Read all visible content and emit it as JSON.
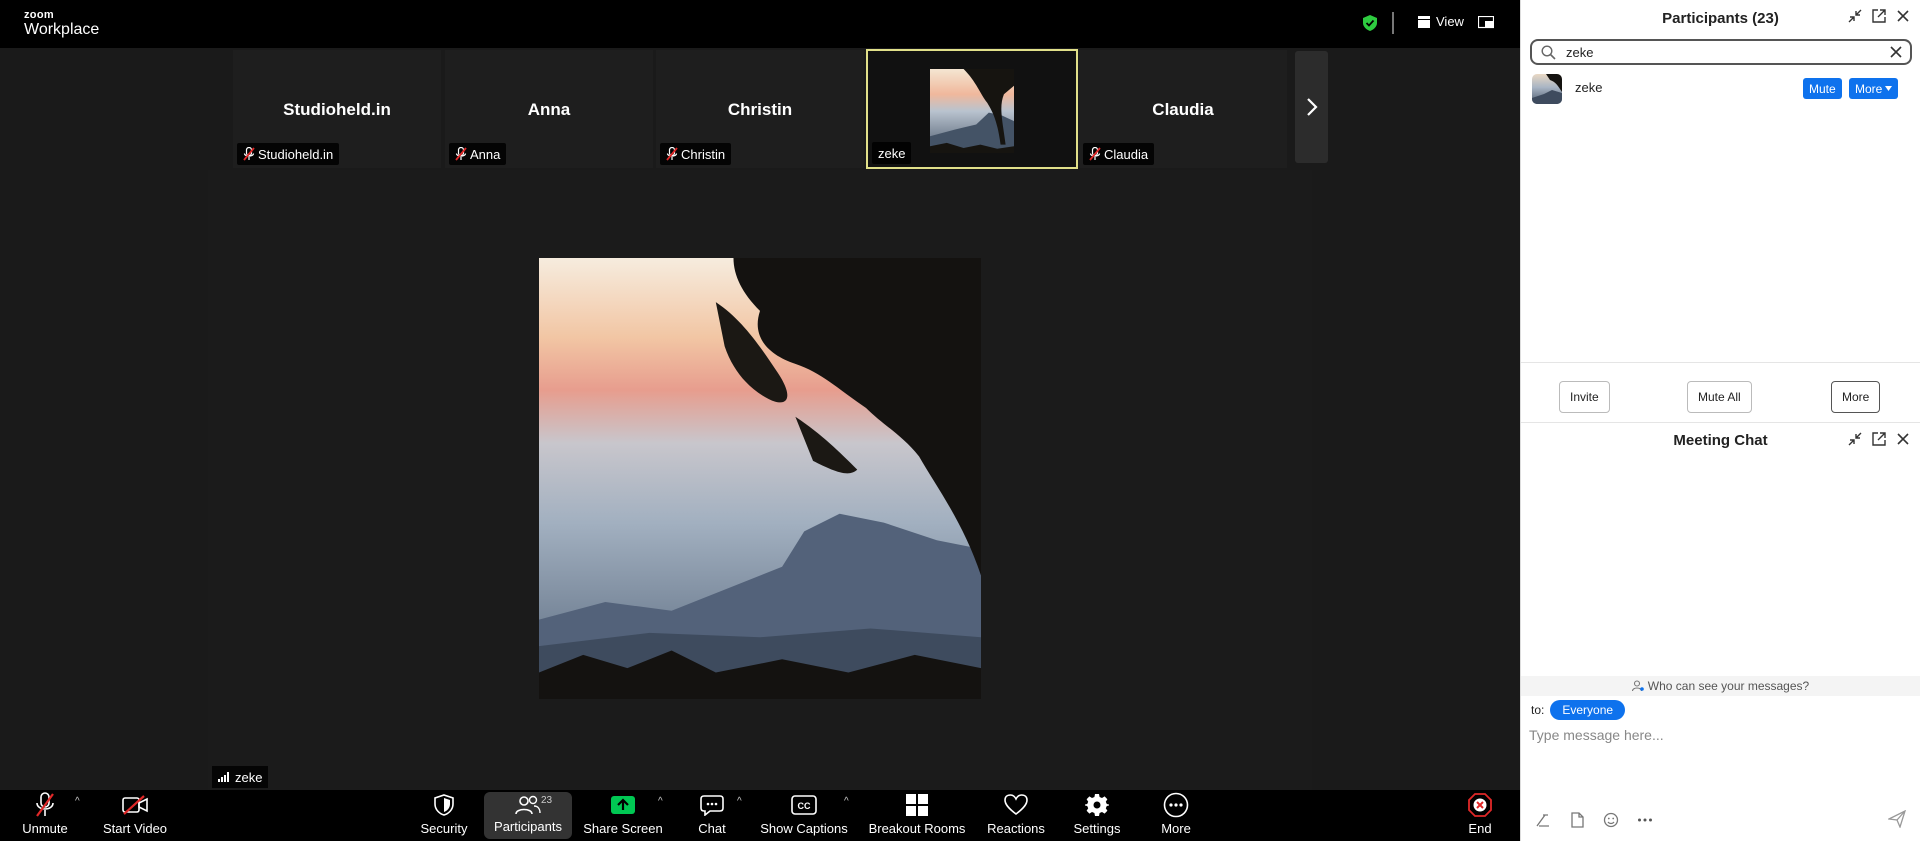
{
  "app": {
    "logo_top": "zoom",
    "logo_bottom": "Workplace",
    "view_label": "View"
  },
  "thumbnails": [
    {
      "name": "Studioheld.in",
      "tag": "Studioheld.in",
      "muted": true
    },
    {
      "name": "Anna",
      "tag": "Anna",
      "muted": true
    },
    {
      "name": "Christin",
      "tag": "Christin",
      "muted": true
    },
    {
      "name": "",
      "tag": "zeke",
      "muted": false,
      "active": true
    },
    {
      "name": "Claudia",
      "tag": "Claudia",
      "muted": true
    }
  ],
  "stage": {
    "speaker_tag": "zeke"
  },
  "toolbar": {
    "unmute": "Unmute",
    "start_video": "Start Video",
    "security": "Security",
    "participants": "Participants",
    "participants_count": "23",
    "share_screen": "Share Screen",
    "chat": "Chat",
    "show_captions": "Show Captions",
    "breakout_rooms": "Breakout Rooms",
    "reactions": "Reactions",
    "settings": "Settings",
    "more": "More",
    "end": "End"
  },
  "participants_panel": {
    "title": "Participants (23)",
    "search_value": "zeke",
    "results": [
      {
        "name": "zeke",
        "mute_label": "Mute",
        "more_label": "More"
      }
    ],
    "invite": "Invite",
    "mute_all": "Mute All",
    "more": "More"
  },
  "chat_panel": {
    "title": "Meeting Chat",
    "who_can_see": "Who can see your messages?",
    "to_label": "to:",
    "recipient": "Everyone",
    "placeholder": "Type message here..."
  },
  "colors": {
    "accent_blue": "#0e72ed",
    "active_border": "#e1e08a",
    "muted_red": "#e02828",
    "share_green": "#00c853",
    "secure_green": "#2ecc40"
  }
}
